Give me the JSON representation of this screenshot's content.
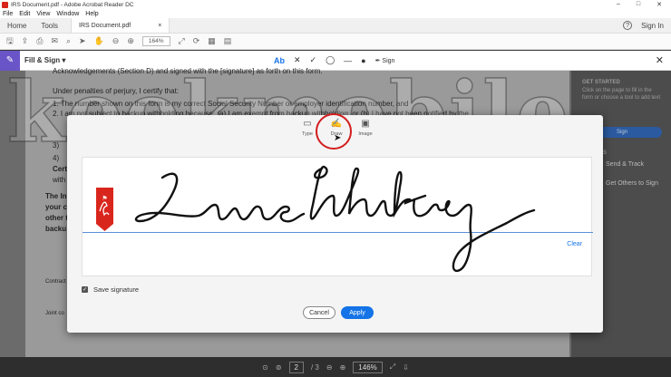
{
  "window": {
    "title": "IRS Document.pdf - Adobe Acrobat Reader DC",
    "controls": [
      "–",
      "□",
      "✕"
    ]
  },
  "menu": [
    "File",
    "Edit",
    "View",
    "Window",
    "Help"
  ],
  "tabs": {
    "home": "Home",
    "tools": "Tools",
    "document": "IRS Document.pdf",
    "document_close": "×",
    "help": "?",
    "sign_in": "Sign In"
  },
  "toolbar": {
    "zoom": "164%"
  },
  "fill_sign": {
    "label": "Fill & Sign ▾",
    "text_tool": "Ab",
    "cross_tool": "✕",
    "check_tool": "✓",
    "circle_tool": "◯",
    "line_tool": "—",
    "dot_tool": "●",
    "sign_label": "Sign",
    "close": "✕"
  },
  "document": {
    "line1": "Acknowledgements (Section D) and signed with the [signature] as forth on this form.",
    "line2": "Under penalties of perjury, I certify that:",
    "line3": "1. The number shown on this form is my correct Social Security Number or employer identification number, and",
    "line4": "2. I am not subject to backup withholding because: (a) I am exempt from backup withholding, or (b) I have not been notified by the",
    "line5": "3)",
    "line6": "4)",
    "line7": "Cert",
    "line8": "with",
    "box1": "The In",
    "box2": "your c",
    "box3": "other t",
    "box4": "backu",
    "contract": "Contract",
    "joint": "Joint co"
  },
  "right_panel": {
    "heading": "GET STARTED",
    "text": "Click on the page to fill in the form or choose a tool to add text",
    "sign": "Sign",
    "options": "OPTIONS",
    "send_track": "Send & Track",
    "get_others": "Get Others to Sign"
  },
  "watermark": "kookmobile",
  "modal": {
    "tabs": [
      {
        "label": "Type",
        "icon": "type-icon"
      },
      {
        "label": "Draw",
        "icon": "draw-pen-icon"
      },
      {
        "label": "Image",
        "icon": "image-icon"
      }
    ],
    "active_tab": "Draw",
    "clear": "Clear",
    "save_signature": "Save signature",
    "cancel": "Cancel",
    "apply": "Apply"
  },
  "bottom": {
    "page_current": "2",
    "page_total": "/ 3",
    "zoom": "146%"
  },
  "colors": {
    "accent": "#1473e6",
    "fill_sign_purple": "#6a55c8",
    "highlight_red": "#d21d1d",
    "adobe_red": "#d9261c"
  }
}
